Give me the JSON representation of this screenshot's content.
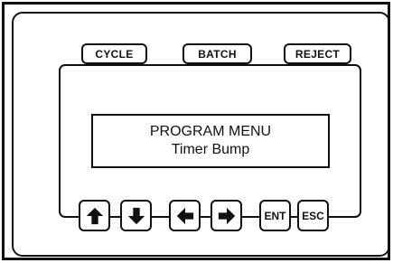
{
  "top_keys": [
    {
      "label": "CYCLE",
      "icon": "cycle-key"
    },
    {
      "label": "BATCH",
      "icon": "batch-key"
    },
    {
      "label": "REJECT",
      "icon": "reject-key"
    }
  ],
  "display": {
    "line1": "PROGRAM MENU",
    "line2": "Timer Bump"
  },
  "keypad": {
    "up_icon": "arrow-up-icon",
    "down_icon": "arrow-down-icon",
    "left_icon": "arrow-left-icon",
    "right_icon": "arrow-right-icon",
    "enter_label": "ENT",
    "escape_label": "ESC"
  }
}
